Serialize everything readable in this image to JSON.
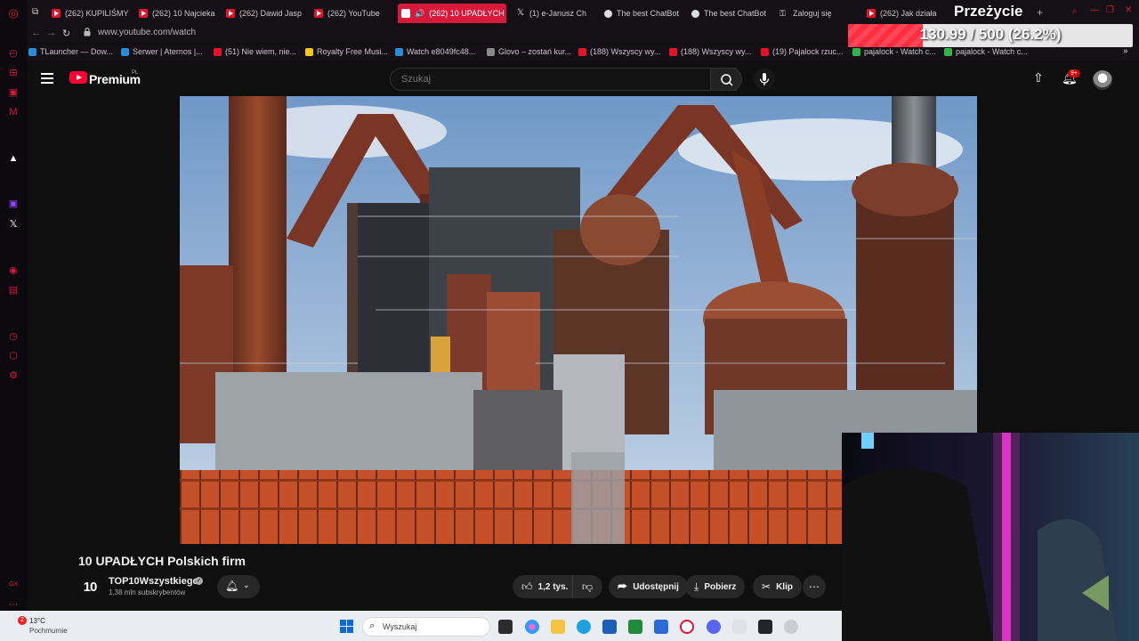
{
  "browser": {
    "tabs": [
      {
        "label": "(262) KUPILIŚMY",
        "icon": "youtube-icon"
      },
      {
        "label": "(262) 10 Najcieka",
        "icon": "youtube-icon"
      },
      {
        "label": "(262) Dawid Jasp",
        "icon": "youtube-icon"
      },
      {
        "label": "(262) YouTube",
        "icon": "youtube-icon"
      },
      {
        "label": "(262) 10 UPADŁYCH",
        "icon": "youtube-icon",
        "active": true
      },
      {
        "label": "(1) e-Janusz Ch",
        "icon": "x-icon"
      },
      {
        "label": "The best ChatBot",
        "icon": "chatgpt-icon"
      },
      {
        "label": "The best ChatBot",
        "icon": "chatgpt-icon"
      },
      {
        "label": "Zaloguj się",
        "icon": "key-icon"
      },
      {
        "label": "(262) Jak działa",
        "icon": "youtube-icon"
      }
    ],
    "url": "www.youtube.com/watch",
    "bookmarks": [
      {
        "label": "TLauncher — Dow...",
        "color": "blue"
      },
      {
        "label": "Serwer | Aternos |...",
        "color": "blue"
      },
      {
        "label": "(51) Nie wiem, nie...",
        "color": "red"
      },
      {
        "label": "Royalty Free Musi...",
        "color": "yellow"
      },
      {
        "label": "Watch e8049fc48...",
        "color": "blue"
      },
      {
        "label": "Glovo – zostań kur...",
        "color": "grey"
      },
      {
        "label": "(188) Wszyscy wy...",
        "color": "red"
      },
      {
        "label": "(188) Wszyscy wy...",
        "color": "red"
      },
      {
        "label": "(19) Pajalock rzuc...",
        "color": "red"
      },
      {
        "label": "pajalock - Watch c...",
        "color": "green"
      },
      {
        "label": "pajalock - Watch c...",
        "color": "green"
      }
    ]
  },
  "overlay": {
    "title": "Przeżycie",
    "progress_text": "130.99 / 500 (26.2%)",
    "progress_fraction": 0.262
  },
  "youtube": {
    "brand": "Premium",
    "country": "PL",
    "search_placeholder": "Szukaj",
    "notification_badge": "9+",
    "video": {
      "title": "10 UPADŁYCH Polskich firm",
      "channel_avatar_text": "10",
      "channel": "TOP10Wszystkiego",
      "subscribers": "1,38 mln subskrybentów",
      "likes": "1,2 tys.",
      "share_label": "Udostępnij",
      "download_label": "Pobierz",
      "clip_label": "Klip"
    }
  },
  "taskbar": {
    "weather_badge": "2",
    "temperature": "13°C",
    "weather": "Pochmurnie",
    "search_label": "Wyszukaj"
  },
  "colors": {
    "accent": "#d8193b",
    "yt_red": "#ff0033",
    "background": "#0f0f0f"
  }
}
